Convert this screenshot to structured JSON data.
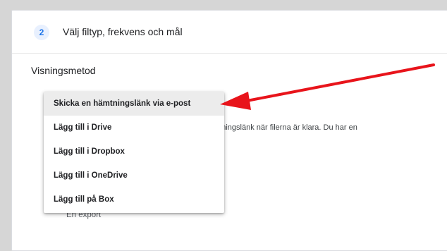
{
  "step": {
    "number": "2",
    "title": "Välj filtyp, frekvens och mål"
  },
  "delivery": {
    "label": "Visningsmetod",
    "options": [
      {
        "label": "Skicka en hämtningslänk via e-post",
        "selected": true
      },
      {
        "label": "Lägg till i Drive",
        "selected": false
      },
      {
        "label": "Lägg till i Dropbox",
        "selected": false
      },
      {
        "label": "Lägg till i OneDrive",
        "selected": false
      },
      {
        "label": "Lägg till på Box",
        "selected": false
      }
    ],
    "hint_fragment": "ddningslänk när filerna är klara. Du har en"
  },
  "frequency": {
    "option_label": "En export"
  },
  "colors": {
    "accent": "#1a73e8",
    "arrow": "#e8141b",
    "selected_row": "#ececec"
  }
}
